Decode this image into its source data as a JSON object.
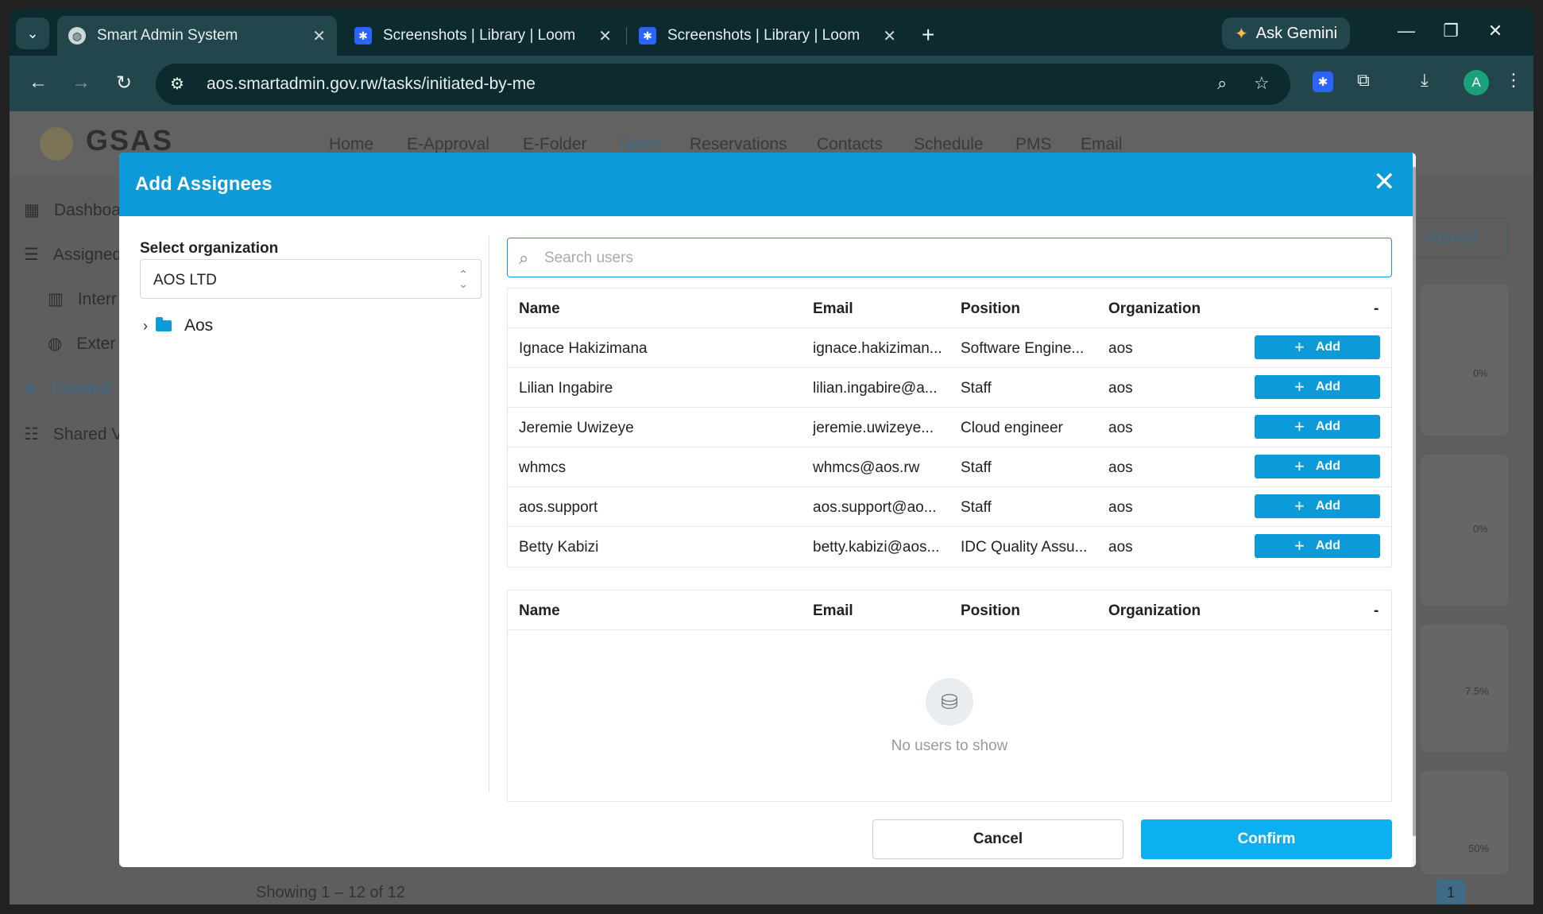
{
  "browser": {
    "tabs": [
      {
        "title": "Smart Admin System",
        "active": true
      },
      {
        "title": "Screenshots | Library | Loom",
        "active": false
      },
      {
        "title": "Screenshots | Library | Loom",
        "active": false
      }
    ],
    "url": "aos.smartadmin.gov.rw/tasks/initiated-by-me",
    "gemini_label": "Ask Gemini",
    "profile_initial": "A"
  },
  "background_page": {
    "logo_text": "GSAS",
    "nav": [
      "Home",
      "E-Approval",
      "E-Folder",
      "Tasks",
      "Reservations",
      "Contacts",
      "Schedule",
      "PMS",
      "Email"
    ],
    "active_nav": "Tasks",
    "sidebar": [
      "Dashboa",
      "Assigned",
      "Interr",
      "Exter",
      "Initiated",
      "Shared V"
    ],
    "upload_label": "Upload",
    "percent_labels": [
      "0%",
      "0%",
      "7.5%",
      "50%"
    ],
    "showing_text": "Showing 1 – 12 of 12",
    "page_number": "1"
  },
  "modal": {
    "title": "Add Assignees",
    "org_label": "Select organization",
    "org_value": "AOS LTD",
    "tree_root": "Aos",
    "search_placeholder": "Search users",
    "columns": [
      "Name",
      "Email",
      "Position",
      "Organization",
      "-"
    ],
    "add_label": "Add",
    "users": [
      {
        "name": "Ignace Hakizimana",
        "email": "ignace.hakiziman...",
        "position": "Software Engine...",
        "org": "aos"
      },
      {
        "name": "Lilian Ingabire",
        "email": "lilian.ingabire@a...",
        "position": "Staff",
        "org": "aos"
      },
      {
        "name": "Jeremie Uwizeye",
        "email": "jeremie.uwizeye...",
        "position": "Cloud engineer",
        "org": "aos"
      },
      {
        "name": "whmcs",
        "email": "whmcs@aos.rw",
        "position": "Staff",
        "org": "aos"
      },
      {
        "name": "aos.support",
        "email": "aos.support@ao...",
        "position": "Staff",
        "org": "aos"
      },
      {
        "name": "Betty Kabizi",
        "email": "betty.kabizi@aos...",
        "position": "IDC Quality Assu...",
        "org": "aos"
      }
    ],
    "empty_text": "No users to show",
    "cancel_label": "Cancel",
    "confirm_label": "Confirm"
  },
  "colors": {
    "accent": "#0c9bd8",
    "confirm": "#0cb0f0",
    "chrome": "#23464c"
  }
}
